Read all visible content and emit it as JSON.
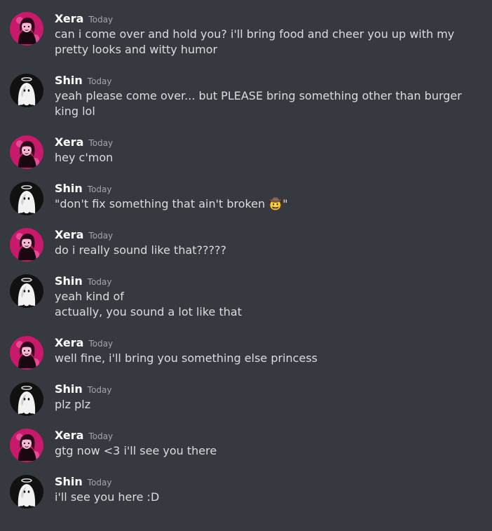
{
  "messages": [
    {
      "author": "Xera",
      "avatar": "xera",
      "timestamp": "Today",
      "lines": [
        "can i come over and hold you? i'll bring food and cheer you up with my pretty looks and witty humor"
      ]
    },
    {
      "author": "Shin",
      "avatar": "shin",
      "timestamp": "Today",
      "lines": [
        "yeah please come over... but PLEASE bring something other than burger king lol"
      ]
    },
    {
      "author": "Xera",
      "avatar": "xera",
      "timestamp": "Today",
      "lines": [
        "hey c'mon"
      ]
    },
    {
      "author": "Shin",
      "avatar": "shin",
      "timestamp": "Today",
      "lines": [
        "\"don't fix something that ain't broken 🤠\""
      ]
    },
    {
      "author": "Xera",
      "avatar": "xera",
      "timestamp": "Today",
      "lines": [
        "do i really sound like that?????"
      ]
    },
    {
      "author": "Shin",
      "avatar": "shin",
      "timestamp": "Today",
      "lines": [
        "yeah kind of",
        "actually, you sound a lot like that"
      ]
    },
    {
      "author": "Xera",
      "avatar": "xera",
      "timestamp": "Today",
      "lines": [
        "well fine, i'll bring you something else princess"
      ]
    },
    {
      "author": "Shin",
      "avatar": "shin",
      "timestamp": "Today",
      "lines": [
        "plz plz"
      ]
    },
    {
      "author": "Xera",
      "avatar": "xera",
      "timestamp": "Today",
      "lines": [
        "gtg now <3 i'll see you there"
      ]
    },
    {
      "author": "Shin",
      "avatar": "shin",
      "timestamp": "Today",
      "lines": [
        "i'll see you here :D"
      ]
    }
  ],
  "colors": {
    "background": "#36393f",
    "username": "#ffffff",
    "timestamp": "#a3a6aa",
    "message_text": "#dcddde",
    "xera_avatar_bg": "#c8196a",
    "shin_avatar_bg": "#111111"
  }
}
